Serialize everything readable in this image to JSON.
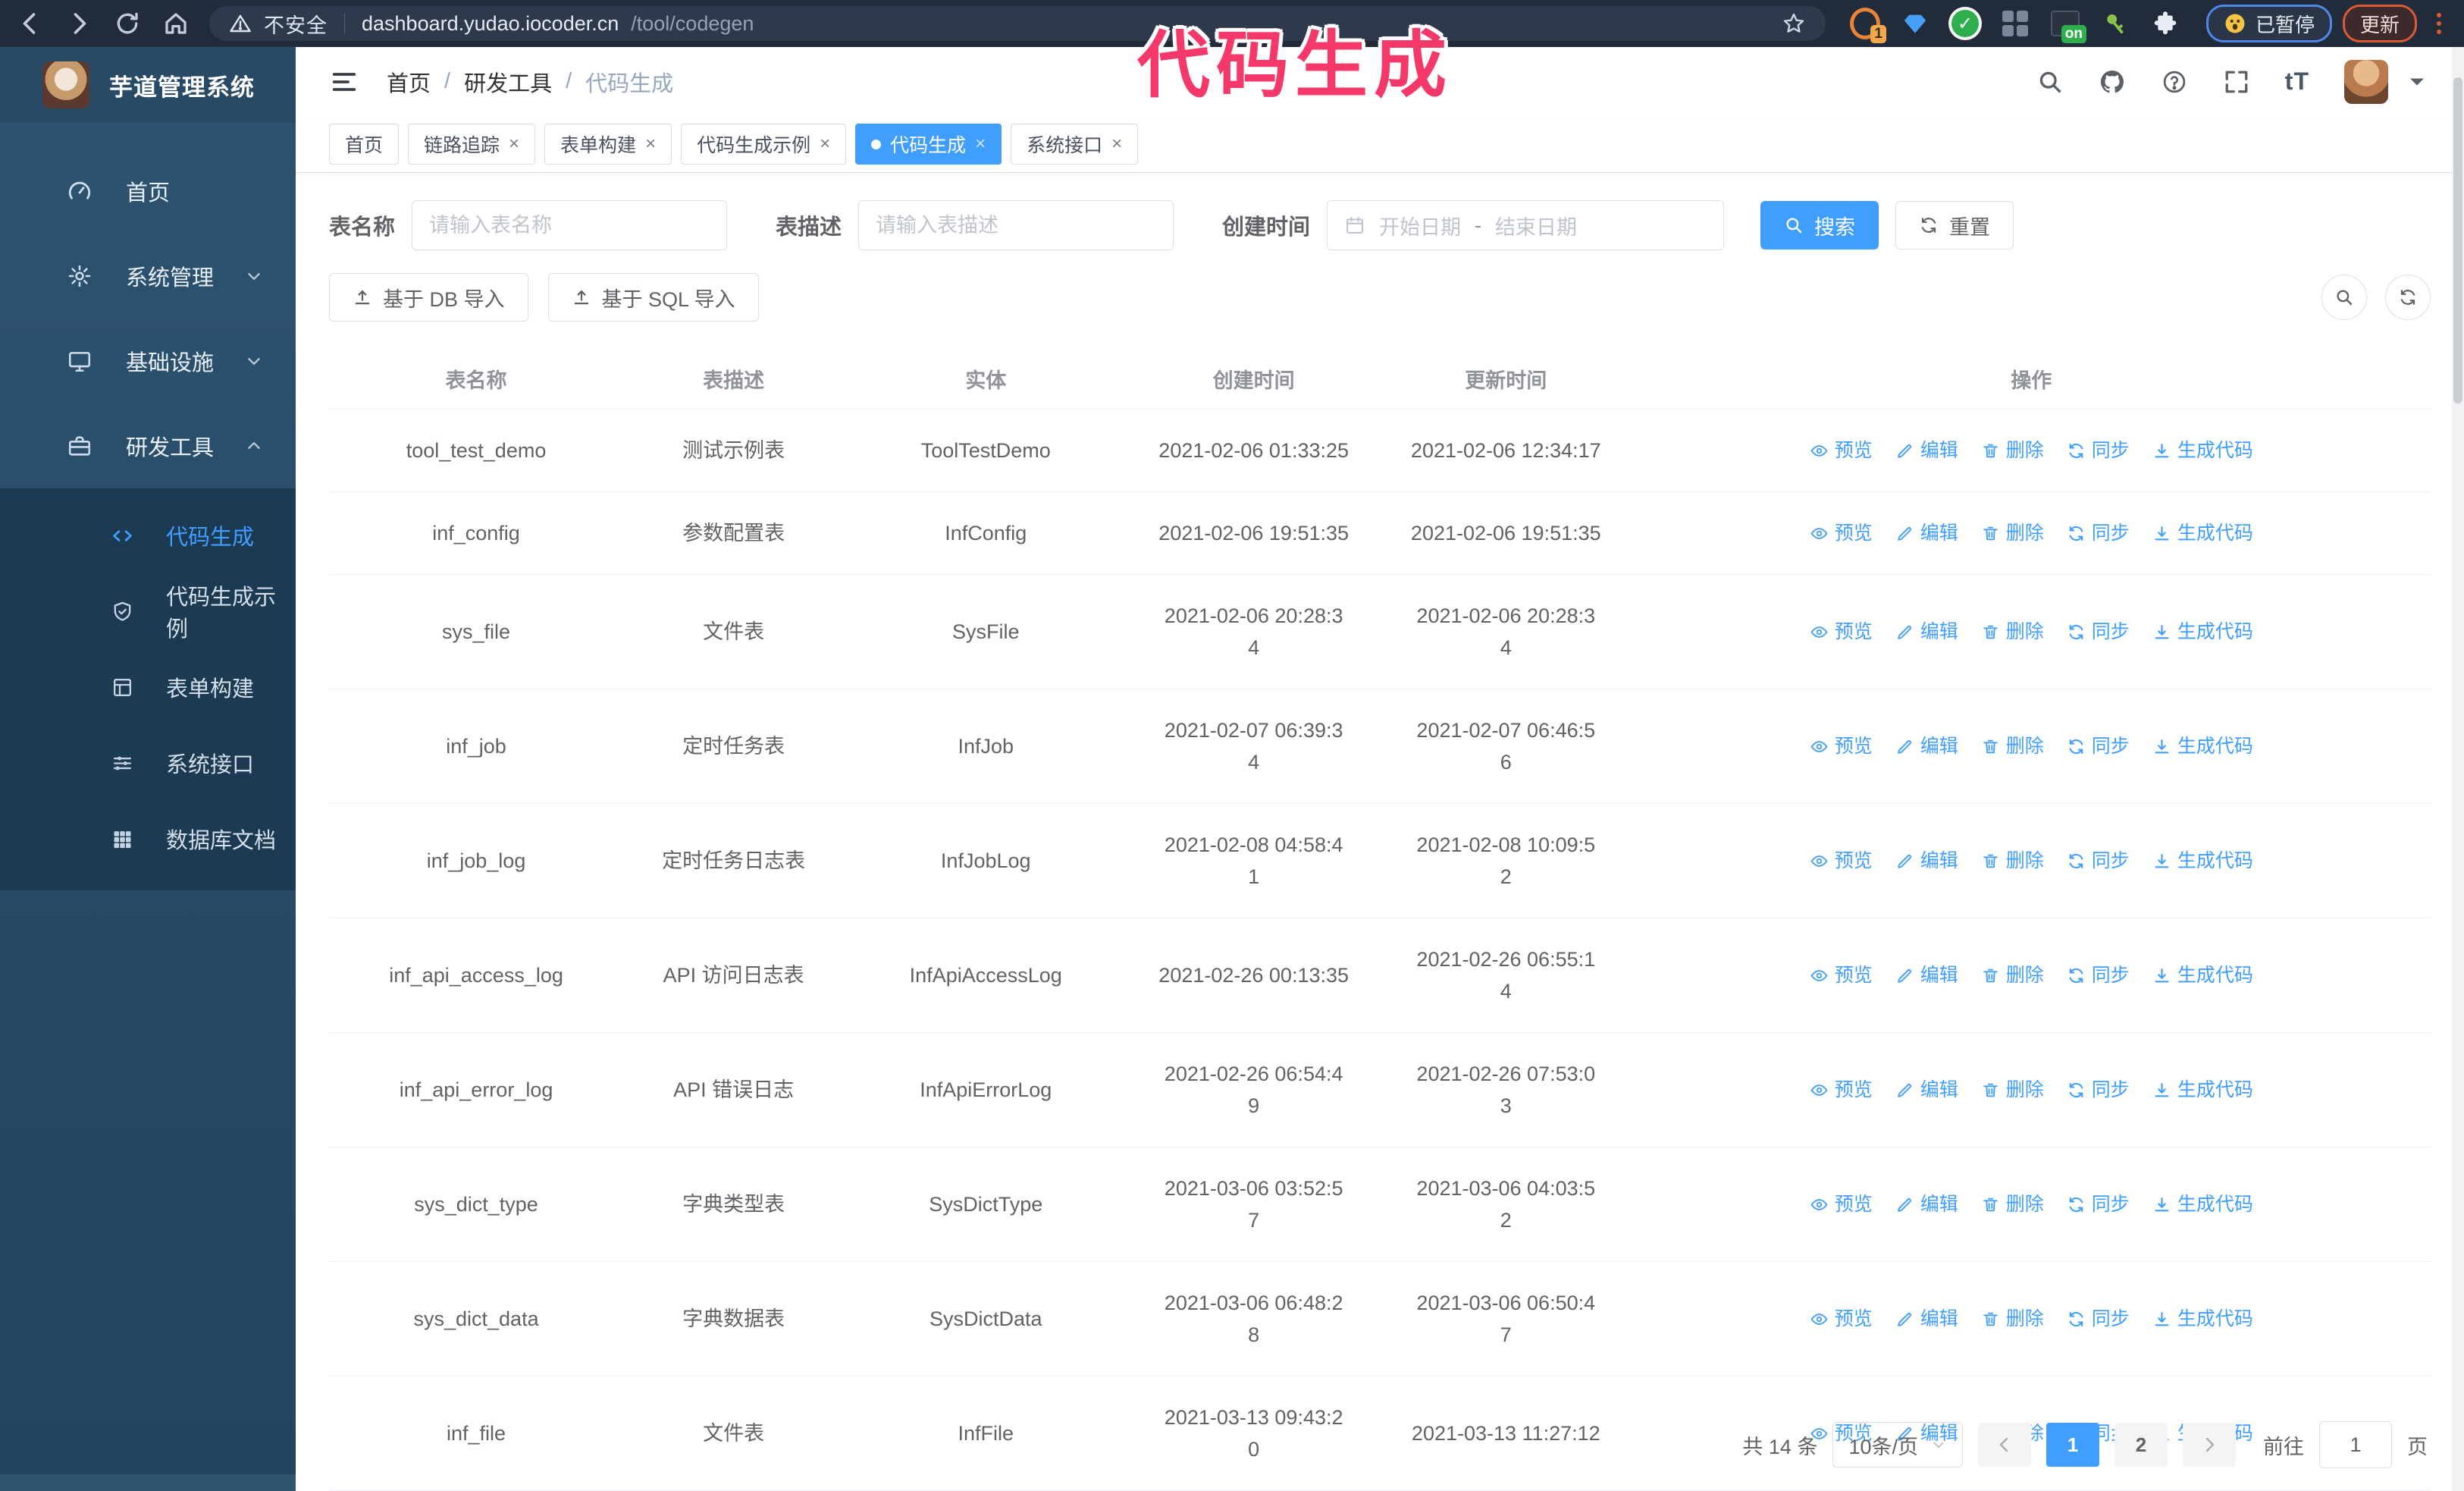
{
  "colors": {
    "accent": "#409EFF",
    "annotation": "#F5386A",
    "update_orange": "#D95B35",
    "paused_blue": "#4F86E8"
  },
  "annotation": {
    "text": "代码生成"
  },
  "ui": {
    "close_glyph": "×",
    "font_size_glyph": "tT"
  },
  "browser": {
    "security_label": "不安全",
    "url_host": "dashboard.yudao.iocoder.cn",
    "url_path": "/tool/codegen",
    "paused_label": "已暂停",
    "update_label": "更新",
    "extension_icons": [
      {
        "name": "extension-orange-icon",
        "badge": "1"
      },
      {
        "name": "extension-gem-icon"
      },
      {
        "name": "extension-check-icon"
      },
      {
        "name": "extension-grid-icon"
      },
      {
        "name": "extension-dark-icon",
        "badge": "on",
        "badge_color": "green"
      },
      {
        "name": "extension-key-icon"
      },
      {
        "name": "extensions-puzzle-icon"
      }
    ]
  },
  "sidebar": {
    "logo_title": "芋道管理系统",
    "items": [
      {
        "icon": "dashboard-icon",
        "label": "首页"
      },
      {
        "icon": "gear-icon",
        "label": "系统管理",
        "expandable": true,
        "expanded": false
      },
      {
        "icon": "monitor-icon",
        "label": "基础设施",
        "expandable": true,
        "expanded": false
      },
      {
        "icon": "toolbox-icon",
        "label": "研发工具",
        "expandable": true,
        "expanded": true,
        "children": [
          {
            "icon": "code-icon",
            "label": "代码生成",
            "active": true
          },
          {
            "icon": "shield-check-icon",
            "label": "代码生成示例"
          },
          {
            "icon": "form-icon",
            "label": "表单构建"
          },
          {
            "icon": "sliders-icon",
            "label": "系统接口"
          },
          {
            "icon": "grid-icon",
            "label": "数据库文档"
          }
        ]
      }
    ]
  },
  "topbar": {
    "breadcrumb": [
      "首页",
      "研发工具",
      "代码生成"
    ],
    "separator": "/"
  },
  "tabs": [
    {
      "label": "首页",
      "closable": false,
      "active": false
    },
    {
      "label": "链路追踪",
      "closable": true,
      "active": false
    },
    {
      "label": "表单构建",
      "closable": true,
      "active": false
    },
    {
      "label": "代码生成示例",
      "closable": true,
      "active": false
    },
    {
      "label": "代码生成",
      "closable": true,
      "active": true
    },
    {
      "label": "系统接口",
      "closable": true,
      "active": false
    }
  ],
  "filters": {
    "name_label": "表名称",
    "name_placeholder": "请输入表名称",
    "desc_label": "表描述",
    "desc_placeholder": "请输入表描述",
    "time_label": "创建时间",
    "start_placeholder": "开始日期",
    "separator": "-",
    "end_placeholder": "结束日期",
    "search_label": "搜索",
    "reset_label": "重置"
  },
  "toolbar": {
    "db_import_label": "基于 DB 导入",
    "sql_import_label": "基于 SQL 导入"
  },
  "table": {
    "columns": [
      "表名称",
      "表描述",
      "实体",
      "创建时间",
      "更新时间",
      "操作"
    ],
    "actions": [
      {
        "icon": "eye-icon",
        "label": "预览"
      },
      {
        "icon": "edit-icon",
        "label": "编辑"
      },
      {
        "icon": "delete-icon",
        "label": "删除"
      },
      {
        "icon": "sync-icon",
        "label": "同步"
      },
      {
        "icon": "download-icon",
        "label": "生成代码"
      }
    ],
    "rows": [
      {
        "name": "tool_test_demo",
        "desc": "测试示例表",
        "entity": "ToolTestDemo",
        "created": "2021-02-06 01:33:25",
        "updated": "2021-02-06 12:34:17"
      },
      {
        "name": "inf_config",
        "desc": "参数配置表",
        "entity": "InfConfig",
        "created": "2021-02-06 19:51:35",
        "updated": "2021-02-06 19:51:35"
      },
      {
        "name": "sys_file",
        "desc": "文件表",
        "entity": "SysFile",
        "created": "2021-02-06 20:28:3\n4",
        "updated": "2021-02-06 20:28:3\n4"
      },
      {
        "name": "inf_job",
        "desc": "定时任务表",
        "entity": "InfJob",
        "created": "2021-02-07 06:39:3\n4",
        "updated": "2021-02-07 06:46:5\n6"
      },
      {
        "name": "inf_job_log",
        "desc": "定时任务日志表",
        "entity": "InfJobLog",
        "created": "2021-02-08 04:58:4\n1",
        "updated": "2021-02-08 10:09:5\n2"
      },
      {
        "name": "inf_api_access_log",
        "desc": "API 访问日志表",
        "entity": "InfApiAccessLog",
        "created": "2021-02-26 00:13:35",
        "updated": "2021-02-26 06:55:1\n4"
      },
      {
        "name": "inf_api_error_log",
        "desc": "API 错误日志",
        "entity": "InfApiErrorLog",
        "created": "2021-02-26 06:54:4\n9",
        "updated": "2021-02-26 07:53:0\n3"
      },
      {
        "name": "sys_dict_type",
        "desc": "字典类型表",
        "entity": "SysDictType",
        "created": "2021-03-06 03:52:5\n7",
        "updated": "2021-03-06 04:03:5\n2"
      },
      {
        "name": "sys_dict_data",
        "desc": "字典数据表",
        "entity": "SysDictData",
        "created": "2021-03-06 06:48:2\n8",
        "updated": "2021-03-06 06:50:4\n7"
      },
      {
        "name": "inf_file",
        "desc": "文件表",
        "entity": "InfFile",
        "created": "2021-03-13 09:43:2\n0",
        "updated": "2021-03-13 11:27:12"
      }
    ]
  },
  "pagination": {
    "total_text": "共 14 条",
    "page_size": "10条/页",
    "pages": [
      "1",
      "2"
    ],
    "active_page": "1",
    "goto_label": "前往",
    "goto_value": "1",
    "page_unit": "页"
  }
}
